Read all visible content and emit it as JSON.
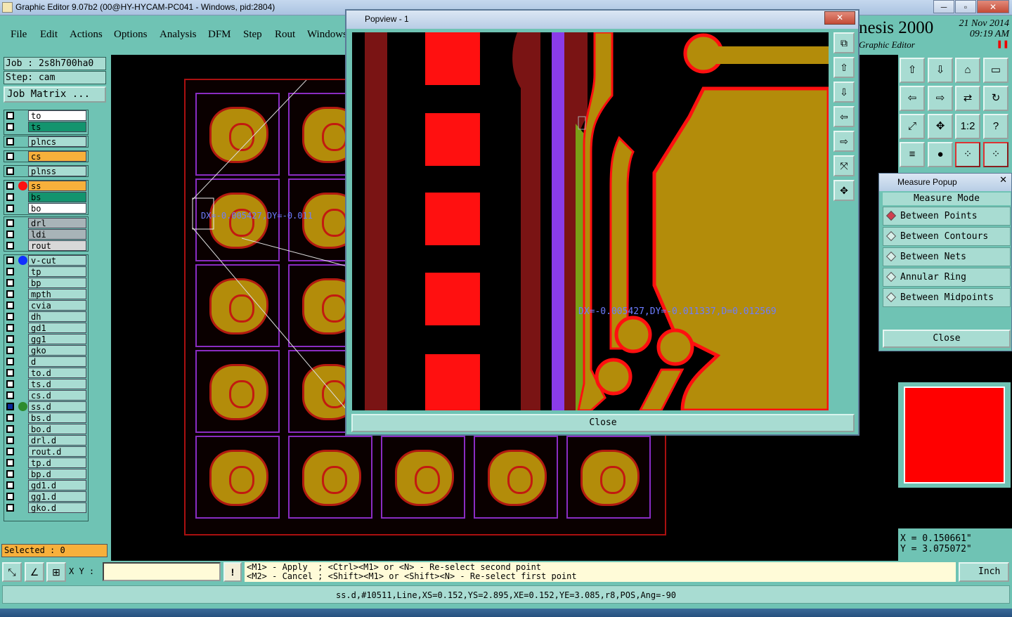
{
  "window": {
    "title": "Graphic Editor 9.07b2 (00@HY-HYCAM-PC041 - Windows, pid:2804)",
    "min": "─",
    "max": "▫",
    "close": "✕"
  },
  "menu": {
    "items": [
      "File",
      "Edit",
      "Actions",
      "Options",
      "Analysis",
      "DFM",
      "Step",
      "Rout",
      "Windows"
    ]
  },
  "brand": {
    "name": "nesis 2000",
    "sub": "Graphic Editor",
    "date": "21 Nov 2014",
    "time": "09:19 AM"
  },
  "job": {
    "job": "Job : 2s8h700ha0",
    "step": "Step: cam",
    "matrix": "Job Matrix ..."
  },
  "layers": {
    "g1": [
      {
        "name": "to",
        "bg": "#ffffff"
      },
      {
        "name": "ts",
        "bg": "#13946e"
      }
    ],
    "g2": [
      {
        "name": "plncs",
        "bg": "#a8dcd2"
      }
    ],
    "g3": [
      {
        "name": "cs",
        "bg": "#f7b03b"
      }
    ],
    "g4": [
      {
        "name": "plnss",
        "bg": "#a8dcd2"
      }
    ],
    "g5": [
      {
        "name": "ss",
        "bg": "#f7b03b",
        "dot": "#ff1010"
      },
      {
        "name": "bs",
        "bg": "#13946e"
      },
      {
        "name": "bo",
        "bg": "#ffffff"
      }
    ],
    "g6": [
      {
        "name": "drl",
        "bg": "#a8b4b8"
      },
      {
        "name": "ldi",
        "bg": "#a8b4b8"
      },
      {
        "name": "rout",
        "bg": "#d8d8d8"
      }
    ],
    "g7": [
      {
        "name": "v-cut",
        "bg": "#a8dcd2",
        "dot": "#1030ff"
      },
      {
        "name": "tp",
        "bg": "#a8dcd2"
      },
      {
        "name": "bp",
        "bg": "#a8dcd2"
      },
      {
        "name": "mpth",
        "bg": "#a8dcd2"
      },
      {
        "name": "cvia",
        "bg": "#a8dcd2"
      },
      {
        "name": "dh",
        "bg": "#a8dcd2"
      },
      {
        "name": "gd1",
        "bg": "#a8dcd2"
      },
      {
        "name": "gg1",
        "bg": "#a8dcd2"
      },
      {
        "name": "gko",
        "bg": "#a8dcd2"
      },
      {
        "name": "d",
        "bg": "#a8dcd2"
      },
      {
        "name": "to.d",
        "bg": "#a8dcd2"
      },
      {
        "name": "ts.d",
        "bg": "#a8dcd2"
      },
      {
        "name": "cs.d",
        "bg": "#a8dcd2"
      },
      {
        "name": "ss.d",
        "bg": "#a8dcd2",
        "dot": "#2e8b2e",
        "checked": true
      },
      {
        "name": "bs.d",
        "bg": "#a8dcd2"
      },
      {
        "name": "bo.d",
        "bg": "#a8dcd2"
      },
      {
        "name": "drl.d",
        "bg": "#a8dcd2"
      },
      {
        "name": "rout.d",
        "bg": "#a8dcd2"
      },
      {
        "name": "tp.d",
        "bg": "#a8dcd2"
      },
      {
        "name": "bp.d",
        "bg": "#a8dcd2"
      },
      {
        "name": "gd1.d",
        "bg": "#a8dcd2"
      },
      {
        "name": "gg1.d",
        "bg": "#a8dcd2"
      },
      {
        "name": "gko.d",
        "bg": "#a8dcd2"
      }
    ]
  },
  "selected": "Selected : 0",
  "canvas": {
    "measure_label": "DX=-0.005427,DY=-0.011"
  },
  "popview": {
    "title": "Popview - 1",
    "close": "Close",
    "measure_label": "DX=-0.005427,DY=-0.011337,D=0.012569"
  },
  "measure_popup": {
    "title": "Measure Popup",
    "header": "Measure Mode",
    "modes": [
      "Between Points",
      "Between Contours",
      "Between Nets",
      "Annular Ring",
      "Between Midpoints"
    ],
    "selected": 0,
    "close": "Close"
  },
  "coords": {
    "x": "X = 0.150661\"",
    "y": "Y = 3.075072\""
  },
  "input": {
    "label": "X Y :",
    "value": "",
    "bang": "!"
  },
  "help": {
    "line1": "<M1> - Apply  ; <Ctrl><M1> or <N> - Re-select second point",
    "line2": "<M2> - Cancel ; <Shift><M1> or <Shift><N> - Re-select first point"
  },
  "units": "Inch",
  "status": "ss.d,#10511,Line,XS=0.152,YS=2.895,XE=0.152,YE=3.085,r8,POS,Ang=-90"
}
